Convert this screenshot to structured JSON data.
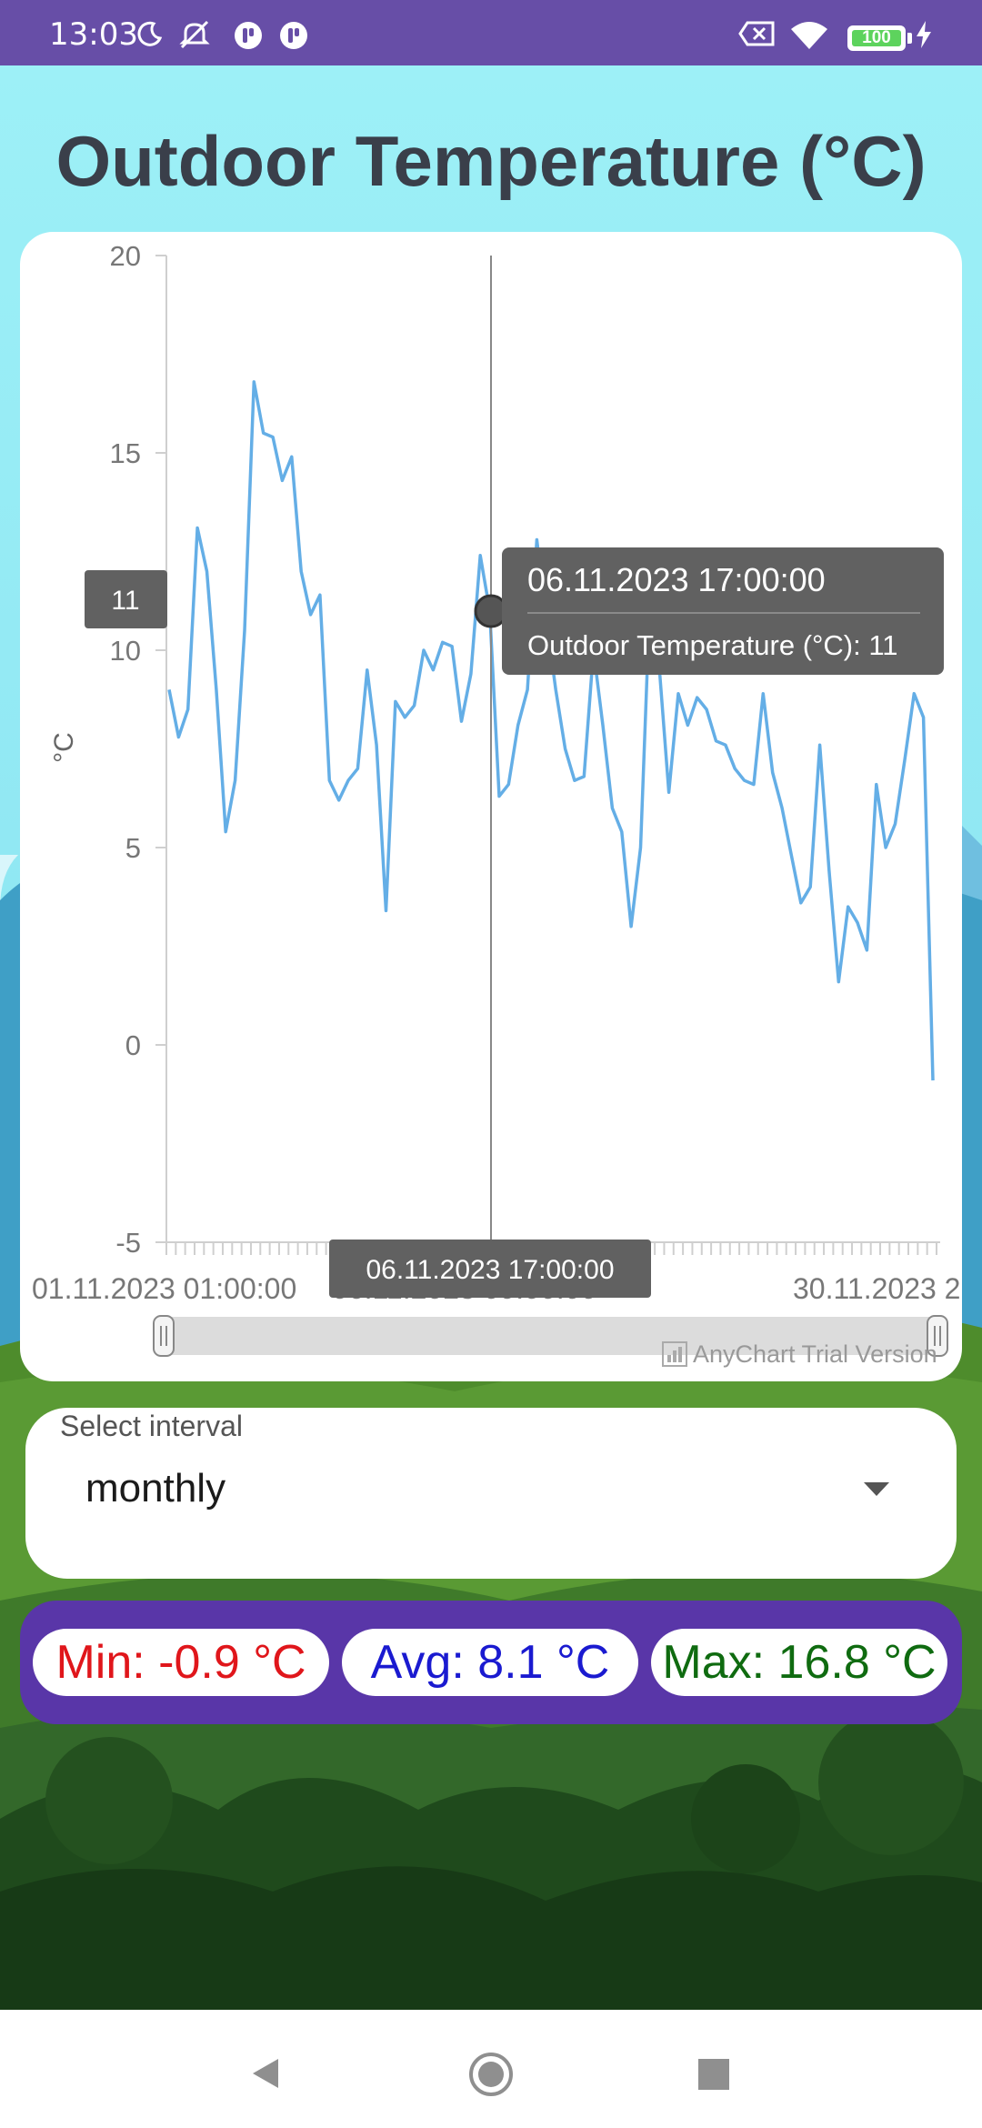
{
  "status_bar": {
    "time": "13:03",
    "battery": "100",
    "icons": [
      "moon-icon",
      "mute-icon",
      "app-icon",
      "app-icon",
      "sim-off-icon",
      "wifi-icon",
      "battery-icon",
      "charging-icon"
    ]
  },
  "page": {
    "title": "Outdoor Temperature (°C)"
  },
  "tooltip": {
    "datetime": "06.11.2023 17:00:00",
    "text": "Outdoor Temperature (°C): 11",
    "y_marker": "11",
    "x_marker": "06.11.2023 17:00:00"
  },
  "scroller": {
    "left_label": "01.11.2023 01:00:00",
    "mid_label": "06.11.2023 09:00:00",
    "right_label": "30.11.2023 2"
  },
  "watermark": "AnyChart Trial Version",
  "interval": {
    "label": "Select interval",
    "value": "monthly"
  },
  "stats": {
    "min": "Min: -0.9 °C",
    "avg": "Avg: 8.1 °C",
    "max": "Max: 16.8 °C"
  },
  "colors": {
    "status_bar": "#674ea7",
    "line": "#64aee6",
    "min": "#e0161b",
    "avg": "#1a1ad0",
    "max": "#0f6b10",
    "stats_bar": "#5936a8"
  },
  "chart_data": {
    "type": "line",
    "ylabel": "°C",
    "ylim": [
      -5,
      20
    ],
    "yticks": [
      20,
      15,
      10,
      5,
      0,
      -5
    ],
    "x_start": "01.11.2023 01:00:00",
    "x_end": "30.11.2023",
    "series": [
      {
        "values": [
          9.0,
          7.8,
          8.5,
          13.1,
          12.0,
          9.0,
          5.4,
          6.7,
          10.5,
          16.8,
          15.5,
          15.4,
          14.3,
          14.9,
          12.0,
          10.9,
          11.4,
          6.7,
          6.2,
          6.7,
          7.0,
          9.5,
          7.6,
          3.4,
          8.7,
          8.3,
          8.6,
          10.0,
          9.5,
          10.2,
          10.1,
          8.2,
          9.4,
          12.4,
          11.0,
          6.3,
          6.6,
          8.1,
          9.0,
          12.8,
          10.8,
          9.0,
          7.5,
          6.7,
          6.8,
          10.0,
          8.1,
          6.0,
          5.4,
          3.0,
          5.0,
          11.4,
          9.5,
          6.4,
          8.9,
          8.1,
          8.8,
          8.5,
          7.7,
          7.6,
          7.0,
          6.7,
          6.6,
          8.9,
          6.9,
          6.0,
          4.8,
          3.6,
          4.0,
          7.6,
          4.4,
          1.6,
          3.5,
          3.1,
          2.4,
          6.6,
          5.0,
          5.6,
          7.2,
          8.9,
          8.3,
          -0.9
        ]
      }
    ]
  }
}
